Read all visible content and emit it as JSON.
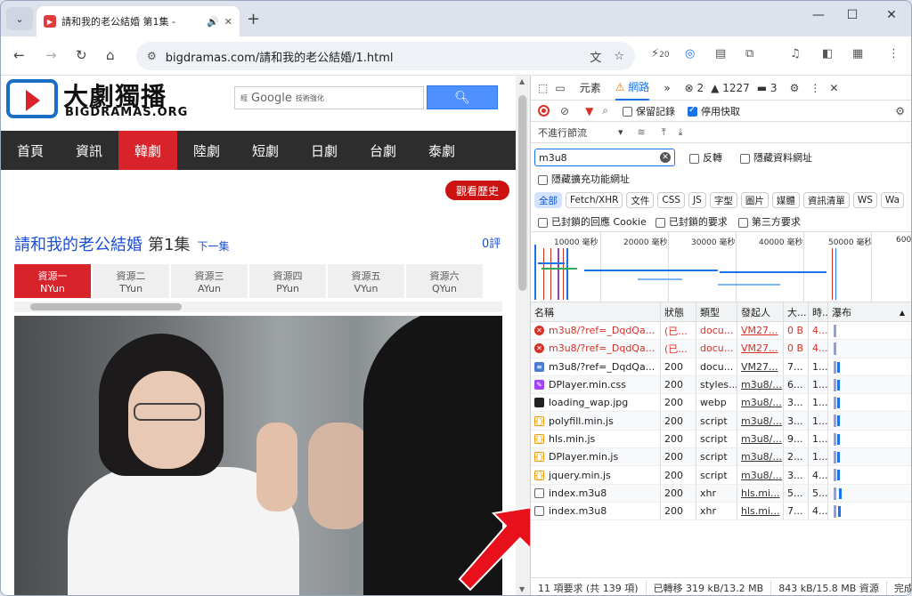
{
  "browser": {
    "tab_title": "請和我的老公結婚 第1集 - ",
    "url": "bigdramas.com/請和我的老公結婚/1.html",
    "ext_badge": "20"
  },
  "site": {
    "logo_main": "大劇獨播",
    "logo_sub": "BIGDRAMAS.ORG",
    "search_prefix": "經",
    "search_google": "Google",
    "search_suffix": "技術強化",
    "nav": [
      "首頁",
      "資訊",
      "韓劇",
      "陸劇",
      "短劇",
      "日劇",
      "台劇",
      "泰劇"
    ],
    "nav_active": 2,
    "history_btn": "觀看歷史",
    "title": "請和我的老公結婚",
    "episode": "第1集",
    "next": "下一集",
    "comments": "0評",
    "sources": [
      {
        "name": "資源一",
        "code": "NYun"
      },
      {
        "name": "資源二",
        "code": "TYun"
      },
      {
        "name": "資源三",
        "code": "AYun"
      },
      {
        "name": "資源四",
        "code": "PYun"
      },
      {
        "name": "資源五",
        "code": "VYun"
      },
      {
        "name": "資源六",
        "code": "QYun"
      }
    ]
  },
  "devtools": {
    "tabs": [
      "元素",
      "網路"
    ],
    "more": "»",
    "errors": "2",
    "warnings": "1227",
    "issues": "3",
    "preserve_log": "保留記錄",
    "disable_cache": "停用快取",
    "throttle": "不進行節流",
    "filter_value": "m3u8",
    "invert": "反轉",
    "hide_data_urls": "隱藏資料網址",
    "hide_ext_urls": "隱藏擴充功能網址",
    "type_filters": [
      "全部",
      "Fetch/XHR",
      "文件",
      "CSS",
      "JS",
      "字型",
      "圖片",
      "媒體",
      "資訊清單",
      "WS",
      "Wa"
    ],
    "blocked_cookies": "已封鎖的回應 Cookie",
    "blocked_requests": "已封鎖的要求",
    "third_party": "第三方要求",
    "timeline_labels": [
      "10000 毫秒",
      "20000 毫秒",
      "30000 毫秒",
      "40000 毫秒",
      "50000 毫秒",
      "600"
    ],
    "columns": [
      "名稱",
      "狀態",
      "類型",
      "發起人",
      "大...",
      "時...",
      "瀑布"
    ],
    "rows": [
      {
        "icon": "red",
        "name": "m3u8/?ref=_DqdQa...",
        "status": "(已...",
        "type": "docu...",
        "initiator": "VM27...",
        "size": "0 B",
        "time": "4...",
        "error": true
      },
      {
        "icon": "red",
        "name": "m3u8/?ref=_DqdQa...",
        "status": "(已...",
        "type": "docu...",
        "initiator": "VM27...",
        "size": "0 B",
        "time": "4...",
        "error": true
      },
      {
        "icon": "doc",
        "name": "m3u8/?ref=_DqdQa...",
        "status": "200",
        "type": "docu...",
        "initiator": "VM27...",
        "size": "7...",
        "time": "1...",
        "error": false
      },
      {
        "icon": "css",
        "name": "DPlayer.min.css",
        "status": "200",
        "type": "styles...",
        "initiator": "m3u8/...",
        "size": "6...",
        "time": "1...",
        "error": false
      },
      {
        "icon": "img",
        "name": "loading_wap.jpg",
        "status": "200",
        "type": "webp",
        "initiator": "m3u8/...",
        "size": "3...",
        "time": "1...",
        "error": false
      },
      {
        "icon": "js",
        "name": "polyfill.min.js",
        "status": "200",
        "type": "script",
        "initiator": "m3u8/...",
        "size": "3...",
        "time": "1...",
        "error": false
      },
      {
        "icon": "js",
        "name": "hls.min.js",
        "status": "200",
        "type": "script",
        "initiator": "m3u8/...",
        "size": "9...",
        "time": "1...",
        "error": false
      },
      {
        "icon": "js",
        "name": "DPlayer.min.js",
        "status": "200",
        "type": "script",
        "initiator": "m3u8/...",
        "size": "2...",
        "time": "1...",
        "error": false
      },
      {
        "icon": "js",
        "name": "jquery.min.js",
        "status": "200",
        "type": "script",
        "initiator": "m3u8/...",
        "size": "3...",
        "time": "4...",
        "error": false
      },
      {
        "icon": "xhr",
        "name": "index.m3u8",
        "status": "200",
        "type": "xhr",
        "initiator": "hls.mi...",
        "size": "5...",
        "time": "5...",
        "error": false
      },
      {
        "icon": "xhr",
        "name": "index.m3u8",
        "status": "200",
        "type": "xhr",
        "initiator": "hls.mi...",
        "size": "7...",
        "time": "4...",
        "error": false
      }
    ],
    "status_bar": [
      "11 項要求 (共 139 項)",
      "已轉移 319 kB/13.2 MB",
      "843 kB/15.8 MB 資源",
      "完成"
    ]
  }
}
